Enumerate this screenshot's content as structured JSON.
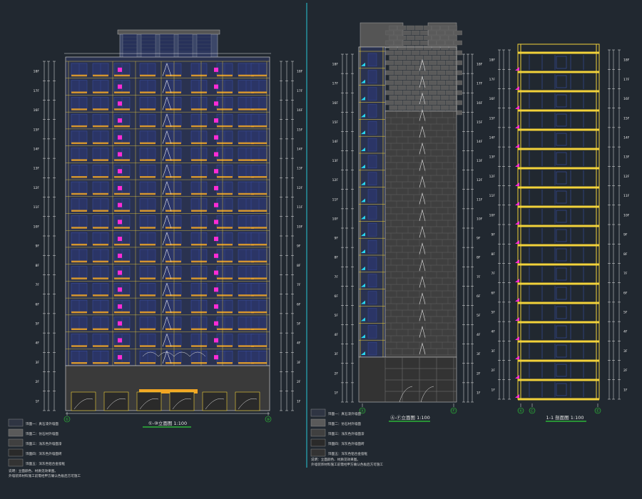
{
  "colors": {
    "background": "#212830",
    "grid_blue": "#3a4fa8",
    "wall_gray": "#6f6f6f",
    "yellow": "#f2d23a",
    "orange": "#f2a623",
    "magenta": "#ff2bd6",
    "cyan": "#27d6ef",
    "white": "#e8e8e8",
    "green": "#2fd23a",
    "divider": "#28c9d8"
  },
  "drawings": [
    {
      "title": "①-⑩立面图 1:100"
    },
    {
      "title": "Ⓐ-Ⓕ立面图 1:100"
    },
    {
      "title": "1-1 剖面图 1:100"
    }
  ],
  "axis_labels": {
    "front_left": "①",
    "front_right": "⑩",
    "side_left": "Ⓐ",
    "side_right": "Ⓕ",
    "section_a": "Ⓐ",
    "section_b": "Ⓒ",
    "section_c": "Ⓔ"
  },
  "floor_labels": [
    "1F",
    "2F",
    "3F",
    "4F",
    "5F",
    "6F",
    "7F",
    "8F",
    "9F",
    "10F",
    "11F",
    "12F",
    "13F",
    "14F",
    "15F",
    "16F",
    "17F",
    "18F"
  ],
  "legend_left": [
    "饰面一：真石漆外墙面",
    "饰面二：仿石材外墙面",
    "饰面三：浅灰色外墙面漆",
    "饰面四：深灰色外墙面砖",
    "饰面五：深灰色铝合金窗框"
  ],
  "legend_right": [
    "饰面一：真石漆外墙面",
    "饰面二：仿石材外墙面",
    "饰面三：浅灰色外墙面漆",
    "饰面四：深灰色外墙面砖",
    "饰面五：深灰色铝合金窗框"
  ],
  "notes_left": [
    "说明：立面颜色、材质见效果图。",
    "外墙装饰材料施工前需经甲方确认色板后方可施工"
  ],
  "notes_right": [
    "说明：立面颜色、材质见效果图。",
    "外墙装饰材料施工前需经甲方确认色板后方可施工"
  ]
}
